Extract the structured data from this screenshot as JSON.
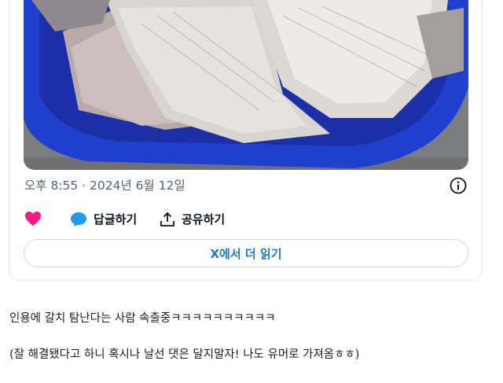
{
  "tweet": {
    "image_alt_icon": "photo-fish-in-blue-basin",
    "timestamp": "오후 8:55 · 2024년 6월 12일",
    "actions": {
      "like_icon": "heart-icon",
      "reply_label": "답글하기",
      "share_label": "공유하기"
    },
    "read_more_label": "X에서 더 읽기"
  },
  "post": {
    "line1": "인용에 갈치 탐난다는 사람 속출중ㅋㅋㅋㅋㅋㅋㅋㅋㅋㅋ",
    "line2": "(잘 해결됐다고 하니 혹시나 날선 댓은 달지말자! 나도 유머로 가져옴ㅎㅎ)"
  },
  "colors": {
    "like": "#f91880",
    "reply": "#1d9bf0",
    "link": "#1d7bc4",
    "basin": "#1f3fcf"
  }
}
